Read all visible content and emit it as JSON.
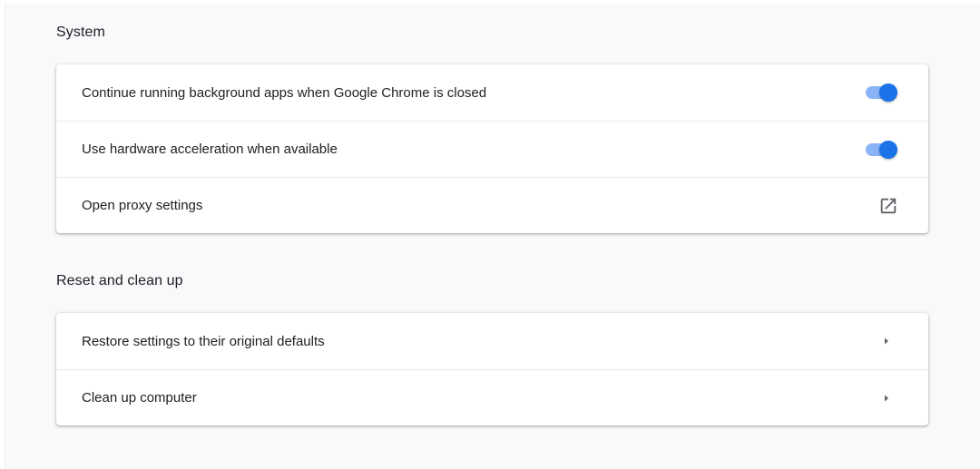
{
  "system": {
    "title": "System",
    "items": [
      {
        "label": "Continue running background apps when Google Chrome is closed",
        "control": "toggle",
        "checked": true
      },
      {
        "label": "Use hardware acceleration when available",
        "control": "toggle",
        "checked": true
      },
      {
        "label": "Open proxy settings",
        "control": "external-link-icon"
      }
    ]
  },
  "reset": {
    "title": "Reset and clean up",
    "items": [
      {
        "label": "Restore settings to their original defaults",
        "control": "arrow-right-icon"
      },
      {
        "label": "Clean up computer",
        "control": "arrow-right-icon"
      }
    ]
  },
  "colors": {
    "page_background": "#f8f9fa",
    "card_background": "#ffffff",
    "toggle_track": "#8ab4f8",
    "toggle_knob": "#1a73e8",
    "icon_gray": "#5f6368",
    "text": "#202124"
  }
}
